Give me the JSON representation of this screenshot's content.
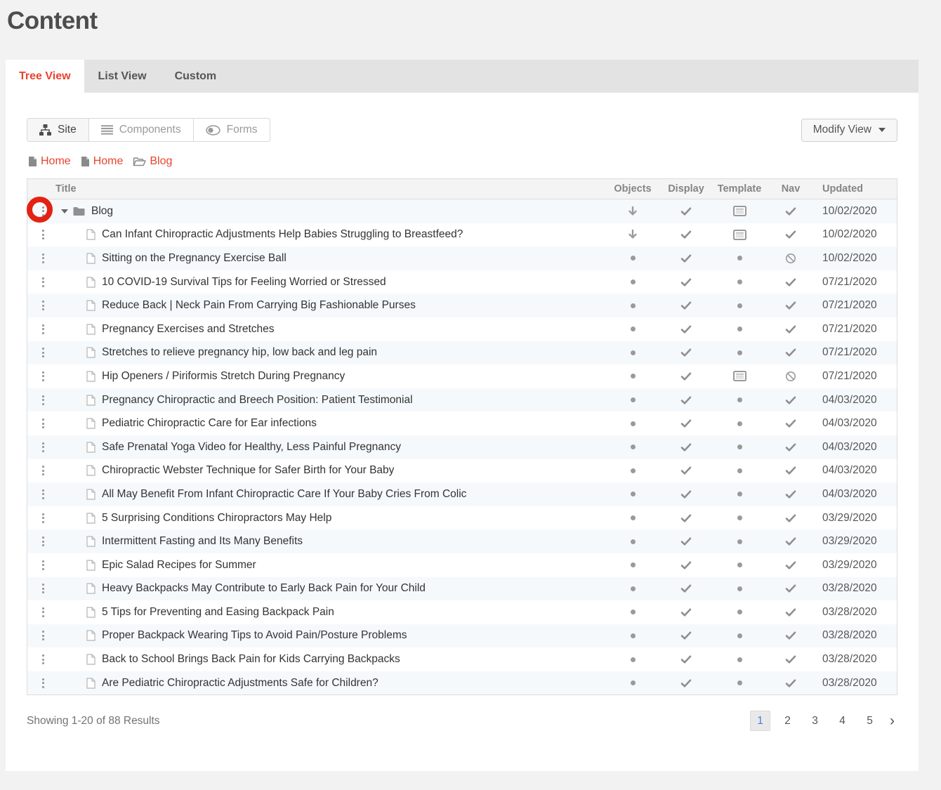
{
  "header": {
    "title": "Content"
  },
  "tabs": [
    {
      "label": "Tree View",
      "active": true
    },
    {
      "label": "List View",
      "active": false
    },
    {
      "label": "Custom",
      "active": false
    }
  ],
  "toolbar": {
    "view_buttons": [
      {
        "label": "Site",
        "icon": "sitemap-icon",
        "active": true
      },
      {
        "label": "Components",
        "icon": "components-icon",
        "active": false
      },
      {
        "label": "Forms",
        "icon": "forms-toggle-icon",
        "active": false
      }
    ],
    "modify_view_label": "Modify View"
  },
  "breadcrumb": [
    {
      "label": "Home",
      "icon": "page-icon"
    },
    {
      "label": "Home",
      "icon": "page-icon"
    },
    {
      "label": "Blog",
      "icon": "open-folder-icon"
    }
  ],
  "table": {
    "columns": [
      "Title",
      "Objects",
      "Display",
      "Template",
      "Nav",
      "Updated"
    ],
    "rows": [
      {
        "title": "Blog",
        "type": "folder",
        "expanded": true,
        "objects": "arrow-down",
        "display": "check",
        "template": "card",
        "nav": "check",
        "updated": "10/02/2020"
      },
      {
        "title": "Can Infant Chiropractic Adjustments Help Babies Struggling to Breastfeed?",
        "type": "page",
        "objects": "arrow-down",
        "display": "check",
        "template": "card",
        "nav": "check",
        "updated": "10/02/2020"
      },
      {
        "title": "Sitting on the Pregnancy Exercise Ball",
        "type": "page",
        "objects": "dot",
        "display": "check",
        "template": "dot",
        "nav": "ban",
        "updated": "10/02/2020"
      },
      {
        "title": "10 COVID-19 Survival Tips for Feeling Worried or Stressed",
        "type": "page",
        "objects": "dot",
        "display": "check",
        "template": "dot",
        "nav": "check",
        "updated": "07/21/2020"
      },
      {
        "title": "Reduce Back | Neck Pain From Carrying Big Fashionable Purses",
        "type": "page",
        "objects": "dot",
        "display": "check",
        "template": "dot",
        "nav": "check",
        "updated": "07/21/2020"
      },
      {
        "title": "Pregnancy Exercises and Stretches",
        "type": "page",
        "objects": "dot",
        "display": "check",
        "template": "dot",
        "nav": "check",
        "updated": "07/21/2020"
      },
      {
        "title": "Stretches to relieve pregnancy hip, low back and leg pain",
        "type": "page",
        "objects": "dot",
        "display": "check",
        "template": "dot",
        "nav": "check",
        "updated": "07/21/2020"
      },
      {
        "title": "Hip Openers / Piriformis Stretch During Pregnancy",
        "type": "page",
        "objects": "dot",
        "display": "check",
        "template": "card",
        "nav": "ban",
        "updated": "07/21/2020"
      },
      {
        "title": "Pregnancy Chiropractic and Breech Position: Patient Testimonial",
        "type": "page",
        "objects": "dot",
        "display": "check",
        "template": "dot",
        "nav": "check",
        "updated": "04/03/2020"
      },
      {
        "title": "Pediatric Chiropractic Care for Ear infections",
        "type": "page",
        "objects": "dot",
        "display": "check",
        "template": "dot",
        "nav": "check",
        "updated": "04/03/2020"
      },
      {
        "title": "Safe Prenatal Yoga Video for Healthy, Less Painful Pregnancy",
        "type": "page",
        "objects": "dot",
        "display": "check",
        "template": "dot",
        "nav": "check",
        "updated": "04/03/2020"
      },
      {
        "title": "Chiropractic Webster Technique for Safer Birth for Your Baby",
        "type": "page",
        "objects": "dot",
        "display": "check",
        "template": "dot",
        "nav": "check",
        "updated": "04/03/2020"
      },
      {
        "title": "All May Benefit From Infant Chiropractic Care If Your Baby Cries From Colic",
        "type": "page",
        "objects": "dot",
        "display": "check",
        "template": "dot",
        "nav": "check",
        "updated": "04/03/2020"
      },
      {
        "title": "5 Surprising Conditions Chiropractors May Help",
        "type": "page",
        "objects": "dot",
        "display": "check",
        "template": "dot",
        "nav": "check",
        "updated": "03/29/2020"
      },
      {
        "title": "Intermittent Fasting and Its Many Benefits",
        "type": "page",
        "objects": "dot",
        "display": "check",
        "template": "dot",
        "nav": "check",
        "updated": "03/29/2020"
      },
      {
        "title": "Epic Salad Recipes for Summer",
        "type": "page",
        "objects": "dot",
        "display": "check",
        "template": "dot",
        "nav": "check",
        "updated": "03/29/2020"
      },
      {
        "title": "Heavy Backpacks May Contribute to Early Back Pain for Your Child",
        "type": "page",
        "objects": "dot",
        "display": "check",
        "template": "dot",
        "nav": "check",
        "updated": "03/28/2020"
      },
      {
        "title": "5 Tips for Preventing and Easing Backpack Pain",
        "type": "page",
        "objects": "dot",
        "display": "check",
        "template": "dot",
        "nav": "check",
        "updated": "03/28/2020"
      },
      {
        "title": "Proper Backpack Wearing Tips to Avoid Pain/Posture Problems",
        "type": "page",
        "objects": "dot",
        "display": "check",
        "template": "dot",
        "nav": "check",
        "updated": "03/28/2020"
      },
      {
        "title": "Back to School Brings Back Pain for Kids Carrying Backpacks",
        "type": "page",
        "objects": "dot",
        "display": "check",
        "template": "dot",
        "nav": "check",
        "updated": "03/28/2020"
      },
      {
        "title": "Are Pediatric Chiropractic Adjustments Safe for Children?",
        "type": "page",
        "objects": "dot",
        "display": "check",
        "template": "dot",
        "nav": "check",
        "updated": "03/28/2020"
      }
    ]
  },
  "footer": {
    "summary": "Showing 1-20 of 88 Results",
    "pages": [
      "1",
      "2",
      "3",
      "4",
      "5"
    ],
    "active_page": "1",
    "next_label": "›"
  },
  "annotation": {
    "shape": "circle",
    "target": "blog-row-menu",
    "color": "#e32213"
  },
  "colors": {
    "accent_red": "#e8432d",
    "annotation_red": "#e32213",
    "active_page_blue": "#4a7fd8",
    "row_stripe": "#f5f9fc",
    "tabbar_gray": "#e3e3e3"
  }
}
